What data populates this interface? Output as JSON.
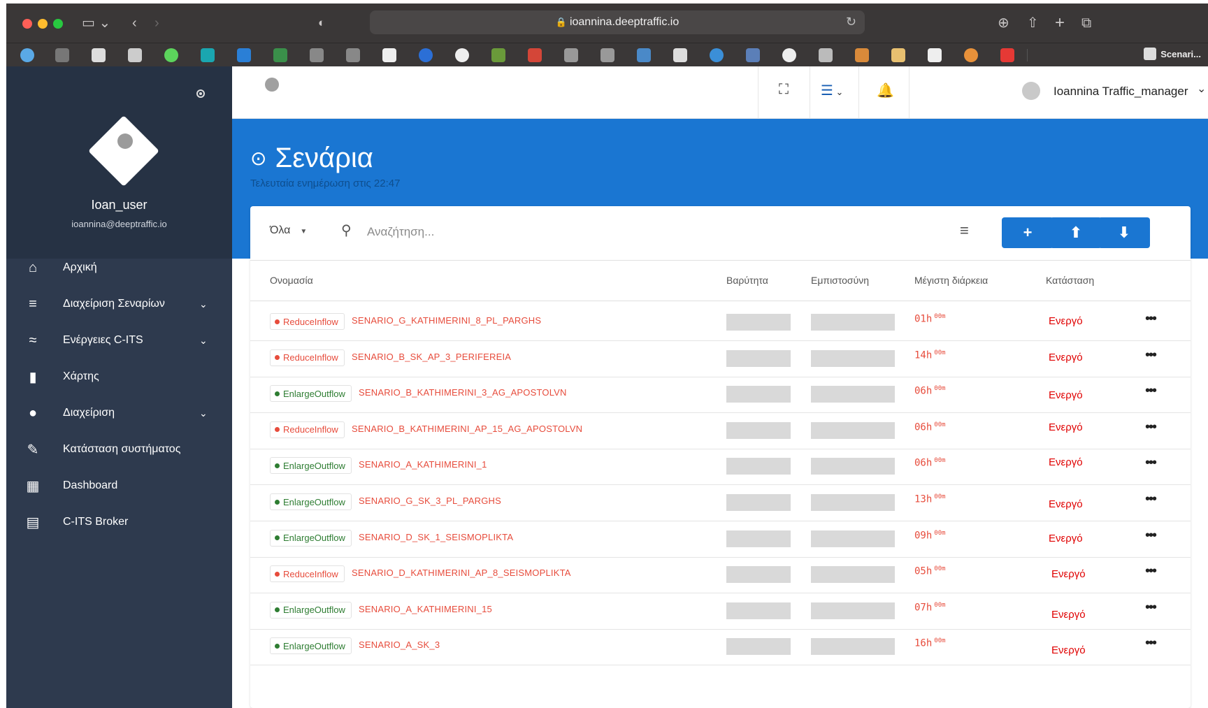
{
  "browser": {
    "url": "ioannina.deeptraffic.io",
    "last_bookmark": "Scenari..."
  },
  "sidebar": {
    "username": "Ioan_user",
    "email": "ioannina@deeptraffic.io",
    "items": [
      {
        "label": "Αρχική",
        "icon": "home-icon",
        "glyph": "⌂",
        "expand": false
      },
      {
        "label": "Διαχείριση Σεναρίων",
        "icon": "menu-icon",
        "glyph": "≡",
        "expand": true
      },
      {
        "label": "Ενέργειες C-ITS",
        "icon": "signal-icon",
        "glyph": "≈",
        "expand": true
      },
      {
        "label": "Χάρτης",
        "icon": "map-icon",
        "glyph": "▮",
        "expand": false
      },
      {
        "label": "Διαχείριση",
        "icon": "admin-icon",
        "glyph": "●",
        "expand": true
      },
      {
        "label": "Κατάσταση συστήματος",
        "icon": "wrench-icon",
        "glyph": "✎",
        "expand": false
      },
      {
        "label": "Dashboard",
        "icon": "dashboard-icon",
        "glyph": "▦",
        "expand": false
      },
      {
        "label": "C-ITS Broker",
        "icon": "chat-icon",
        "glyph": "▤",
        "expand": false
      }
    ]
  },
  "header": {
    "user": "Ioannina Traffic_manager"
  },
  "banner": {
    "title": "Σενάρια",
    "subtitle": "Τελευταία ενημέρωση στις 22:47"
  },
  "toolbar": {
    "filter": "Όλα",
    "search_placeholder": "Αναζήτηση...",
    "add": "+",
    "upload": "⬆",
    "download": "⬇"
  },
  "table": {
    "headers": {
      "name": "Ονομασία",
      "weight": "Βαρύτητα",
      "trust": "Εμπιστοσύνη",
      "duration": "Μέγιστη διάρκεια",
      "status": "Κατάσταση"
    },
    "rows": [
      {
        "type": "ReduceInflow",
        "name": "SENARIO_G_KATHIMERINI_8_PL_PARGHS",
        "hours": "01h",
        "mins": "00m",
        "status": "Ενεργό"
      },
      {
        "type": "ReduceInflow",
        "name": "SENARIO_B_SK_AP_3_PERIFEREIA",
        "hours": "14h",
        "mins": "00m",
        "status": "Ενεργό"
      },
      {
        "type": "EnlargeOutflow",
        "name": "SENARIO_B_KATHIMERINI_3_AG_APOSTOLVN",
        "hours": "06h",
        "mins": "00m",
        "status": "Ενεργό"
      },
      {
        "type": "ReduceInflow",
        "name": "SENARIO_B_KATHIMERINI_AP_15_AG_APOSTOLVN",
        "hours": "06h",
        "mins": "00m",
        "status": "Ενεργό"
      },
      {
        "type": "EnlargeOutflow",
        "name": "SENARIO_A_KATHIMERINI_1",
        "hours": "06h",
        "mins": "00m",
        "status": "Ενεργό"
      },
      {
        "type": "EnlargeOutflow",
        "name": "SENARIO_G_SK_3_PL_PARGHS",
        "hours": "13h",
        "mins": "00m",
        "status": "Ενεργό"
      },
      {
        "type": "EnlargeOutflow",
        "name": "SENARIO_D_SK_1_SEISMOPLIKTA",
        "hours": "09h",
        "mins": "00m",
        "status": "Ενεργό"
      },
      {
        "type": "ReduceInflow",
        "name": "SENARIO_D_KATHIMERINI_AP_8_SEISMOPLIKTA",
        "hours": "05h",
        "mins": "00m",
        "status": "Ενεργό"
      },
      {
        "type": "EnlargeOutflow",
        "name": "SENARIO_A_KATHIMERINI_15",
        "hours": "07h",
        "mins": "00m",
        "status": "Ενεργό"
      },
      {
        "type": "EnlargeOutflow",
        "name": "SENARIO_A_SK_3",
        "hours": "16h",
        "mins": "00m",
        "status": "Ενεργό"
      }
    ]
  },
  "colors": {
    "brand_blue": "#1a76d2",
    "reduce": "#e74c3c",
    "enlarge": "#2e7d32",
    "status_red": "#e00000"
  }
}
